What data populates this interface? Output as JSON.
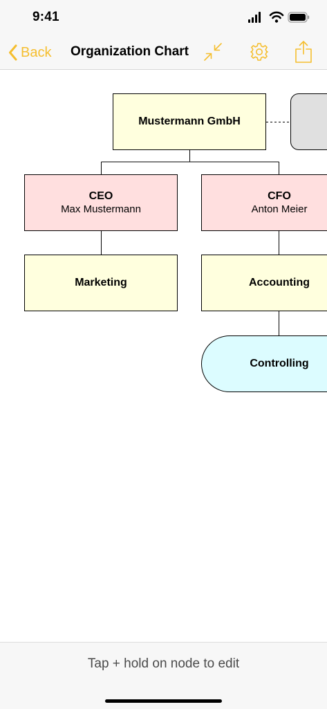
{
  "status_bar": {
    "time": "9:41",
    "icons": [
      "signal-icon",
      "wifi-icon",
      "battery-icon"
    ]
  },
  "nav": {
    "back_label": "Back",
    "title": "Organization Chart",
    "icons": [
      "chevron-left-icon",
      "collapse-icon",
      "gear-icon",
      "share-icon"
    ],
    "accent_color": "#f5be2e"
  },
  "chart": {
    "nodes": {
      "company": {
        "title": "Mustermann GmbH"
      },
      "ceo": {
        "title": "CEO",
        "subtitle": "Max Mustermann"
      },
      "cfo": {
        "title": "CFO",
        "subtitle": "Anton Meier"
      },
      "marketing": {
        "title": "Marketing"
      },
      "accounting": {
        "title": "Accounting"
      },
      "controlling": {
        "title": "Controlling"
      }
    },
    "colors": {
      "yellow": "#ffffde",
      "pink": "#ffdfdf",
      "cyan": "#dcfcff",
      "gray": "#e0e0e0"
    }
  },
  "bottom_bar": {
    "hint": "Tap + hold on node to edit"
  }
}
